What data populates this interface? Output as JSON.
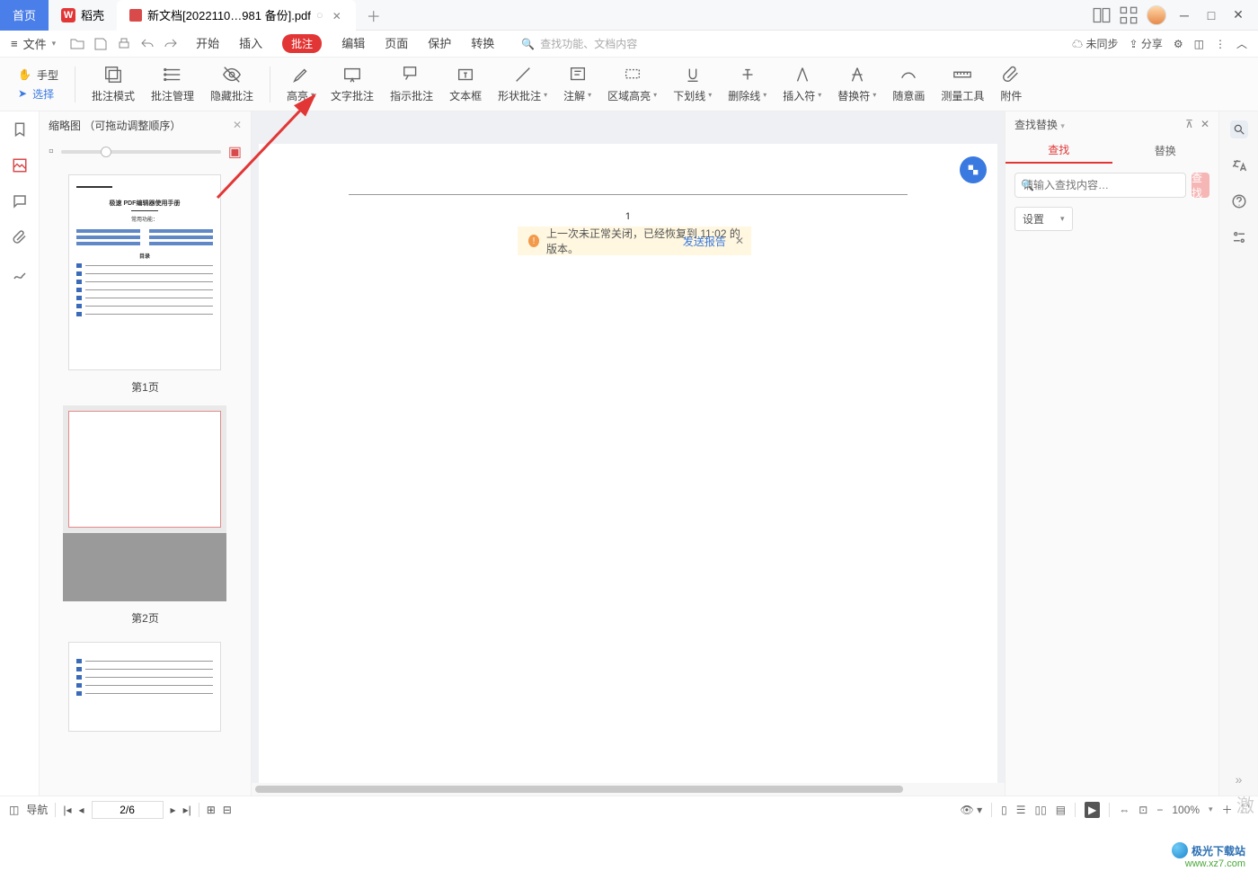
{
  "titlebar": {
    "home": "首页",
    "shell": "稻壳",
    "doc": "新文档[2022110…981 备份].pdf"
  },
  "menu": {
    "file": "文件",
    "items": [
      "开始",
      "插入",
      "批注",
      "编辑",
      "页面",
      "保护",
      "转换"
    ],
    "active_index": 2,
    "search_placeholder": "查找功能、文档内容",
    "sync": "未同步",
    "share": "分享"
  },
  "toolbar": {
    "hand": "手型",
    "select": "选择",
    "mode": "批注模式",
    "manage": "批注管理",
    "hide": "隐藏批注",
    "highlight": "高亮",
    "textannot": "文字批注",
    "indicator": "指示批注",
    "textbox": "文本框",
    "shape": "形状批注",
    "note": "注解",
    "areahl": "区域高亮",
    "underline": "下划线",
    "strike": "删除线",
    "caret": "插入符",
    "replace": "替换符",
    "freehand": "随意画",
    "measure": "测量工具",
    "attach": "附件"
  },
  "notice": {
    "text": "上一次未正常关闭，已经恢复到 11:02 的版本。",
    "send": "发送报告"
  },
  "thumb": {
    "title": "缩略图 （可拖动调整顺序）",
    "page1": "第1页",
    "page2": "第2页",
    "doc_title": "极速 PDF编辑器使用手册",
    "doc_section": "常用功能：",
    "doc_toc": "目录"
  },
  "page": {
    "number": "1"
  },
  "rightpanel": {
    "title": "查找替换",
    "tab_find": "查找",
    "tab_replace": "替换",
    "input_placeholder": "请输入查找内容…",
    "btn": "查找",
    "settings": "设置"
  },
  "statusbar": {
    "nav": "导航",
    "page": "2/6",
    "zoom": "100%"
  },
  "watermark": {
    "line1": "极光下载站",
    "line2": "www.xz7.com"
  }
}
